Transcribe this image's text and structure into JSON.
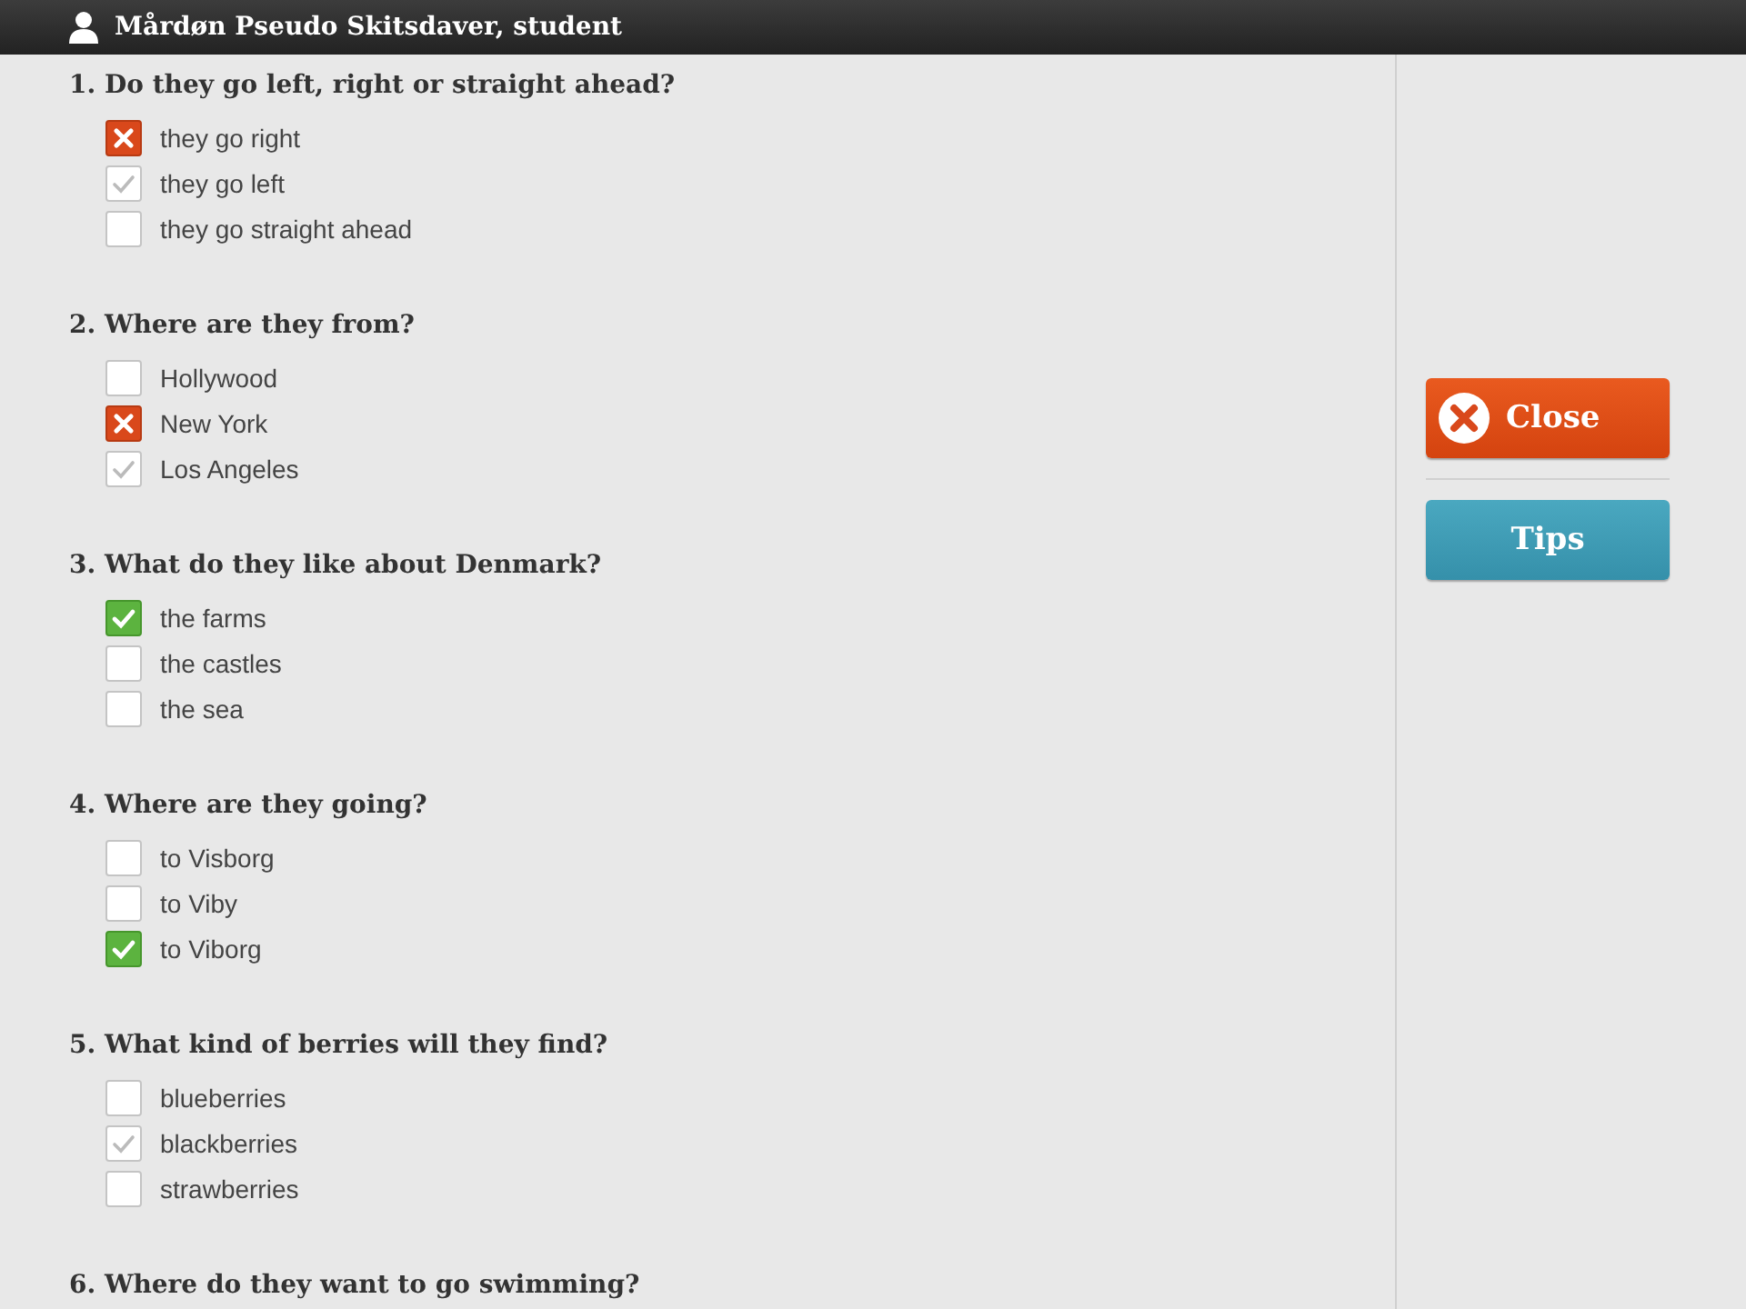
{
  "user": {
    "name": "Mårdøn Pseudo Skitsdaver, student"
  },
  "questions": [
    {
      "title": "1. Do they go left, right or straight ahead?",
      "options": [
        {
          "label": "they go right",
          "checked": true,
          "kind": "wrong"
        },
        {
          "label": "they go left",
          "checked": true,
          "kind": "missed"
        },
        {
          "label": "they go straight ahead",
          "checked": false
        }
      ]
    },
    {
      "title": "2. Where are they from?",
      "options": [
        {
          "label": "Hollywood",
          "checked": false
        },
        {
          "label": "New York",
          "checked": true,
          "kind": "wrong"
        },
        {
          "label": "Los Angeles",
          "checked": true,
          "kind": "missed"
        }
      ]
    },
    {
      "title": "3. What do they like about Denmark?",
      "options": [
        {
          "label": "the farms",
          "checked": true,
          "kind": "correct"
        },
        {
          "label": "the castles",
          "checked": false
        },
        {
          "label": "the sea",
          "checked": false
        }
      ]
    },
    {
      "title": "4. Where are they going?",
      "options": [
        {
          "label": "to Visborg",
          "checked": false
        },
        {
          "label": "to Viby",
          "checked": false
        },
        {
          "label": "to Viborg",
          "checked": true,
          "kind": "correct"
        }
      ]
    },
    {
      "title": "5. What kind of berries will they find?",
      "options": [
        {
          "label": "blueberries",
          "checked": false
        },
        {
          "label": "blackberries",
          "checked": true,
          "kind": "missed"
        },
        {
          "label": "strawberries",
          "checked": false
        }
      ]
    },
    {
      "title": "6. Where do they want to go swimming?"
    }
  ],
  "buttons": [
    {
      "label": "Close",
      "kind": "close"
    },
    {
      "label": "Tips",
      "kind": "tips"
    }
  ]
}
